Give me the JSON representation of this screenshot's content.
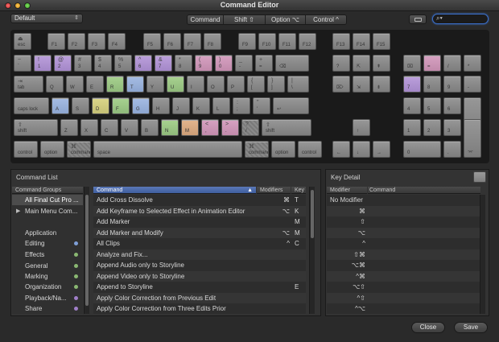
{
  "window": {
    "title": "Command Editor",
    "preset": "Default",
    "modifiers": [
      "Command",
      "Shift ⇧",
      "Option ⌥",
      "Control ^"
    ]
  },
  "colors": {
    "pink": "#d7a2c2",
    "purple": "#bca0dc",
    "green": "#a8d290",
    "yellow": "#dbd68a",
    "blue": "#a6bde4",
    "orange": "#e3b58e",
    "teal": "#9fcfc2",
    "accent": "#3b6fc9"
  },
  "keyboard": {
    "row0": [
      "⏏ esc",
      "F1",
      "F2",
      "F3",
      "F4",
      "F5",
      "F6",
      "F7",
      "F8",
      "F9",
      "F10",
      "F11",
      "F12",
      "F13",
      "F14",
      "F15"
    ],
    "row1": [
      "~ `",
      "! 1",
      "@ 2",
      "# 3",
      "$ 4",
      "% 5",
      "^ 6",
      "& 7",
      "* 8",
      "( 9",
      ") 0",
      "_ -",
      "+ =",
      "⌫"
    ],
    "row1_right": [
      "?",
      "⇱",
      "⇞",
      "⌧",
      "=",
      "/",
      "*"
    ],
    "row2": [
      "⇥ tab",
      "Q",
      "W",
      "E",
      "R",
      "T",
      "Y",
      "U",
      "I",
      "O",
      "P",
      "{ [",
      "} ]",
      "| \\"
    ],
    "row2_right": [
      "⌦",
      "⇲",
      "⇟",
      "7",
      "8",
      "9",
      "-"
    ],
    "row3": [
      "caps lock",
      "A",
      "S",
      "D",
      "F",
      "G",
      "H",
      "J",
      "K",
      "L",
      ": ;",
      "\" '",
      "↩"
    ],
    "row3_right": [
      "4",
      "5",
      "6",
      "+"
    ],
    "row4": [
      "⇧ shift",
      "Z",
      "X",
      "C",
      "V",
      "B",
      "N",
      "M",
      "< ,",
      "> .",
      "? /",
      "⇧ shift"
    ],
    "row4_right": [
      "↑",
      "1",
      "2",
      "3"
    ],
    "row5": [
      "control",
      "option",
      "⌘ command",
      "space",
      "⌘ command",
      "option",
      "control"
    ],
    "row5_right": [
      "←",
      "↓",
      "→",
      "0",
      ".",
      "⌤"
    ]
  },
  "command_list": {
    "title": "Command List",
    "groups_header": "Command Groups",
    "command_header": "Command",
    "modifiers_header": "Modifiers",
    "key_header": "Key",
    "groups": [
      {
        "label": "All Final Cut Pro ...",
        "color": ""
      },
      {
        "label": "Main Menu Com...",
        "color": ""
      },
      {
        "label": "",
        "color": ""
      },
      {
        "label": "Application",
        "color": ""
      },
      {
        "label": "Editing",
        "color": "#7f9fd8"
      },
      {
        "label": "Effects",
        "color": "#8ab872"
      },
      {
        "label": "General",
        "color": "#8ab872"
      },
      {
        "label": "Marking",
        "color": "#8ab872"
      },
      {
        "label": "Organization",
        "color": "#8ab872"
      },
      {
        "label": "Playback/Na...",
        "color": "#a07fc8"
      },
      {
        "label": "Share",
        "color": "#a07fc8"
      }
    ],
    "commands": [
      {
        "name": "Add Cross Dissolve",
        "mod": "⌘",
        "key": "T"
      },
      {
        "name": "Add Keyframe to Selected Effect in Animation Editor",
        "mod": "⌥",
        "key": "K"
      },
      {
        "name": "Add Marker",
        "mod": "",
        "key": "M"
      },
      {
        "name": "Add Marker and Modify",
        "mod": "⌥",
        "key": "M"
      },
      {
        "name": "All Clips",
        "mod": "^",
        "key": "C"
      },
      {
        "name": "Analyze and Fix...",
        "mod": "",
        "key": ""
      },
      {
        "name": "Append Audio only to Storyline",
        "mod": "",
        "key": ""
      },
      {
        "name": "Append Video only to Storyline",
        "mod": "",
        "key": ""
      },
      {
        "name": "Append to Storyline",
        "mod": "",
        "key": "E"
      },
      {
        "name": "Apply Color Correction from Previous Edit",
        "mod": "",
        "key": ""
      },
      {
        "name": "Apply Color Correction from Three Edits Prior",
        "mod": "",
        "key": ""
      }
    ]
  },
  "key_detail": {
    "title": "Key Detail",
    "modifier_header": "Modifier",
    "command_header": "Command",
    "rows": [
      "No Modifier",
      "⌘",
      "⇧",
      "⌥",
      "^",
      "⇧⌘",
      "⌥⌘",
      "^⌘",
      "⌥⇧",
      "^⇧",
      "^⌥"
    ]
  },
  "buttons": {
    "close": "Close",
    "save": "Save"
  }
}
